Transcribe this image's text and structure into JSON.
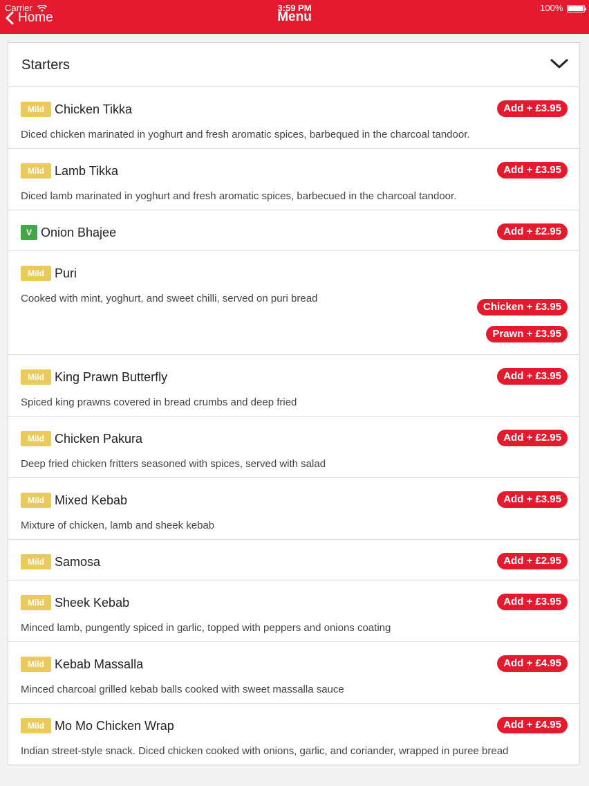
{
  "status_bar": {
    "carrier": "Carrier",
    "time": "3:59 PM",
    "battery": "100%"
  },
  "nav": {
    "back_label": "Home",
    "title": "Menu"
  },
  "section": {
    "title": "Starters"
  },
  "items": [
    {
      "badge": "Mild",
      "name": "Chicken Tikka",
      "description": "Diced chicken marinated in yoghurt and fresh aromatic spices, barbequed in the charcoal tandoor.",
      "buttons": [
        "Add + £3.95"
      ]
    },
    {
      "badge": "Mild",
      "name": "Lamb Tikka",
      "description": "Diced lamb marinated in yoghurt and fresh aromatic spices, barbecued in the charcoal tandoor.",
      "buttons": [
        "Add + £3.95"
      ]
    },
    {
      "badge": "V",
      "name": "Onion Bhajee",
      "description": "",
      "buttons": [
        "Add + £2.95"
      ]
    },
    {
      "badge": "Mild",
      "name": "Puri",
      "description": "Cooked with mint, yoghurt, and sweet chilli, served on puri bread",
      "buttons": [
        "Chicken + £3.95",
        "Prawn + £3.95"
      ]
    },
    {
      "badge": "Mild",
      "name": "King Prawn Butterfly",
      "description": "Spiced king prawns covered in bread crumbs and deep fried",
      "buttons": [
        "Add + £3.95"
      ]
    },
    {
      "badge": "Mild",
      "name": "Chicken Pakura",
      "description": "Deep fried chicken fritters seasoned with spices, served with salad",
      "buttons": [
        "Add + £2.95"
      ]
    },
    {
      "badge": "Mild",
      "name": "Mixed Kebab",
      "description": "Mixture of chicken, lamb and sheek kebab",
      "buttons": [
        "Add + £3.95"
      ]
    },
    {
      "badge": "Mild",
      "name": "Samosa",
      "description": "",
      "buttons": [
        "Add + £2.95"
      ]
    },
    {
      "badge": "Mild",
      "name": "Sheek Kebab",
      "description": "Minced lamb, pungently spiced in garlic, topped with peppers and onions coating",
      "buttons": [
        "Add + £3.95"
      ]
    },
    {
      "badge": "Mild",
      "name": "Kebab Massalla",
      "description": "Minced charcoal grilled kebab balls cooked with sweet massalla sauce",
      "buttons": [
        "Add + £4.95"
      ]
    },
    {
      "badge": "Mild",
      "name": "Mo Mo Chicken Wrap",
      "description": "Indian street-style snack. Diced chicken cooked with onions, garlic, and coriander, wrapped in puree bread",
      "buttons": [
        "Add + £4.95"
      ]
    }
  ]
}
